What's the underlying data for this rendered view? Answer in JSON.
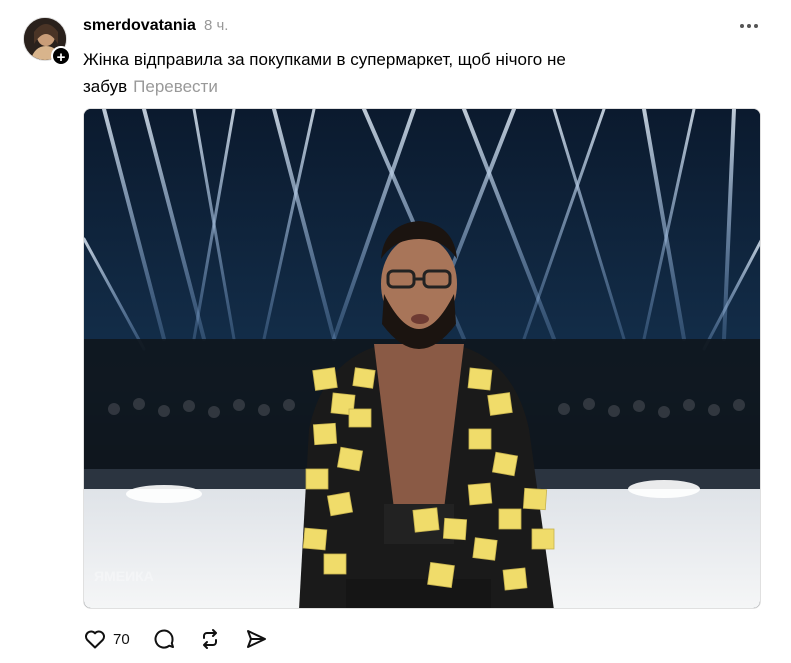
{
  "post": {
    "username": "smerdovatania",
    "timestamp": "8 ч.",
    "caption": "Жінка відправила за покупками в супермаркет, щоб нічого не забув",
    "translate_label": "Перевести",
    "media": {
      "watermark": "ЯМЕИКА"
    },
    "actions": {
      "like_count": "70"
    }
  },
  "icons": [
    "add-follow-icon",
    "more-icon",
    "heart-icon",
    "comment-icon",
    "repost-icon",
    "share-icon"
  ]
}
